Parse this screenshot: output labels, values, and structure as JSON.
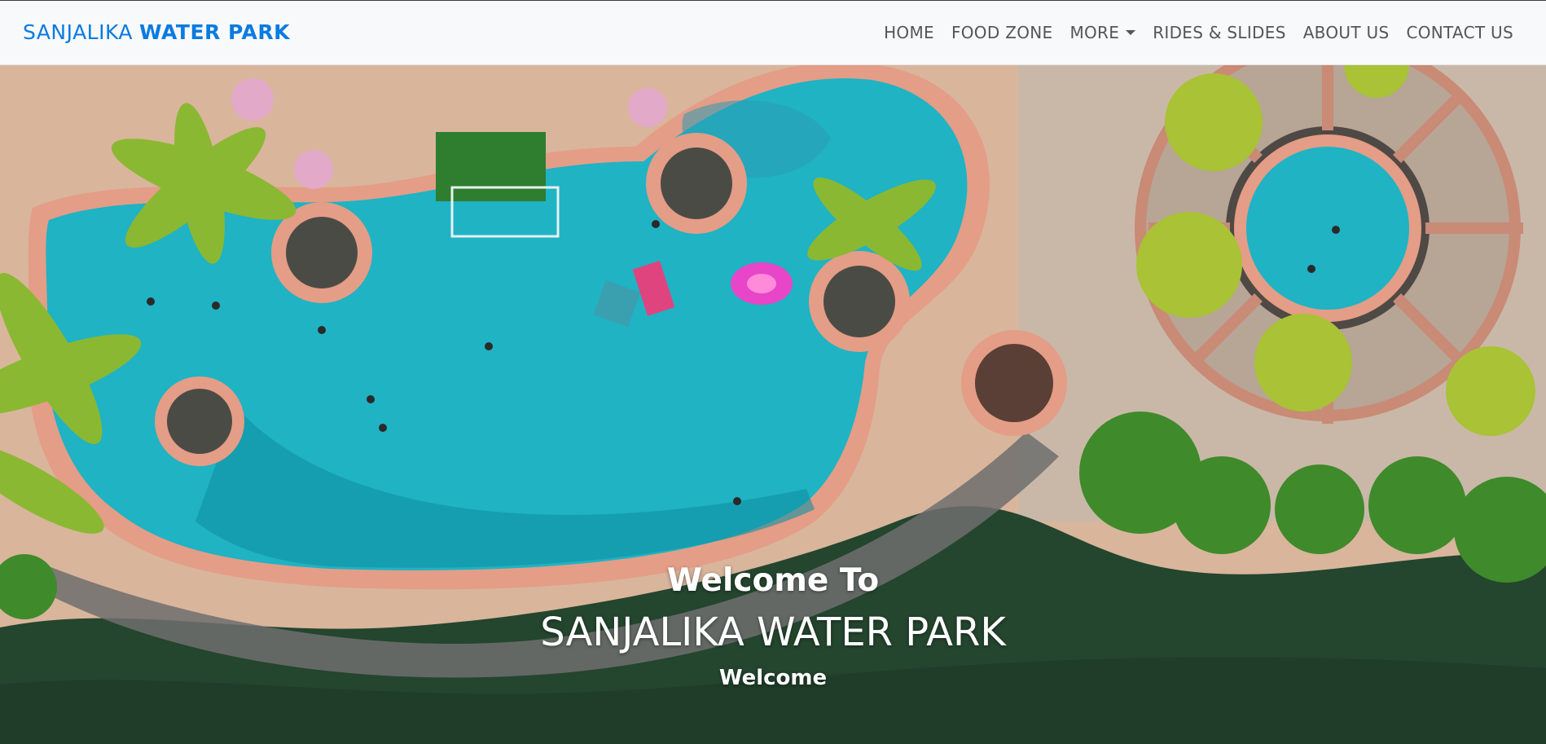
{
  "brand": {
    "part1": "SANJALIKA",
    "part2": "WATER PARK",
    "color": "#0a7be0"
  },
  "nav": {
    "items": [
      {
        "label": "HOME"
      },
      {
        "label": "FOOD ZONE"
      },
      {
        "label": "MORE"
      },
      {
        "label": "RIDES & SLIDES"
      },
      {
        "label": "ABOUT US"
      },
      {
        "label": "CONTACT US"
      }
    ]
  },
  "hero": {
    "caption_title": "Welcome To",
    "caption_heading": "SANJALIKA WATER PARK",
    "caption_sub": "Welcome"
  },
  "colors": {
    "pool": "#1fb3c4",
    "pool_deep": "#0f8fa3",
    "water": "#24452e",
    "deck": "#d9b59c"
  }
}
